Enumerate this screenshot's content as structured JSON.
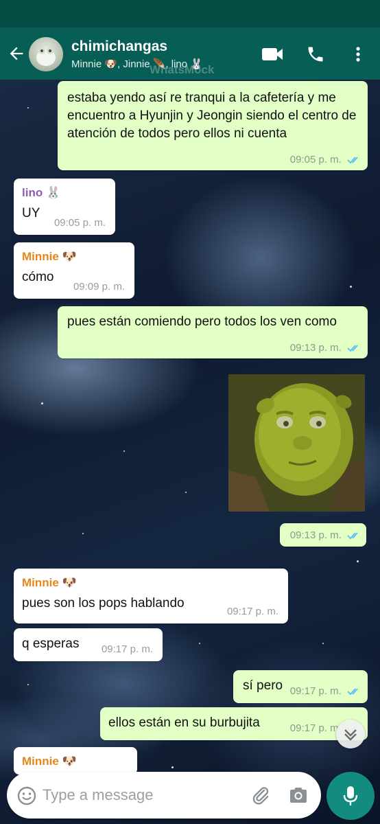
{
  "header": {
    "title": "chimichangas",
    "subtitle": "Minnie 🐶, Jinnie 🪶, lino 🐰",
    "watermark": "WhatsMock"
  },
  "messages": [
    {
      "direction": "out",
      "text": "estaba yendo así re tranqui a la cafetería y me encuentro a Hyunjin y Jeongin siendo el centro de atención de todos pero ellos ni cuenta",
      "time": "09:05 p. m.",
      "read": true
    },
    {
      "direction": "in",
      "sender": "lino 🐰",
      "text": "UY",
      "time": "09:05 p. m."
    },
    {
      "direction": "in",
      "sender": "Minnie 🐶",
      "text": "cómo",
      "time": "09:09 p. m."
    },
    {
      "direction": "out",
      "text": "pues están comiendo pero todos los ven como",
      "time": "09:13 p. m.",
      "read": true
    },
    {
      "direction": "out",
      "type": "image",
      "image": "shrek-face-photo",
      "time": "09:13 p. m.",
      "read": true
    },
    {
      "direction": "in",
      "sender": "Minnie 🐶",
      "text": "pues son los pops hablando",
      "time": "09:17 p. m."
    },
    {
      "direction": "in",
      "text": "q esperas",
      "time": "09:17 p. m."
    },
    {
      "direction": "out",
      "text": "sí pero",
      "time": "09:17 p. m.",
      "read": true
    },
    {
      "direction": "out",
      "text": "ellos están en su burbujita",
      "time": "09:17 p. m.",
      "read": true
    },
    {
      "direction": "in",
      "sender": "Minnie 🐶",
      "text": "",
      "time": ""
    }
  ],
  "input": {
    "placeholder": "Type a message"
  },
  "colors": {
    "header": "#075e54",
    "status_bar": "#054d44",
    "outgoing_bubble": "#e2ffc6",
    "incoming_bubble": "#ffffff",
    "read_ticks": "#4fc3f7",
    "mic_button": "#128c7e"
  },
  "icons": [
    "back-arrow-icon",
    "video-call-icon",
    "phone-icon",
    "menu-icon",
    "double-check-icon",
    "scroll-down-icon",
    "emoji-icon",
    "attach-icon",
    "camera-icon",
    "mic-icon"
  ]
}
